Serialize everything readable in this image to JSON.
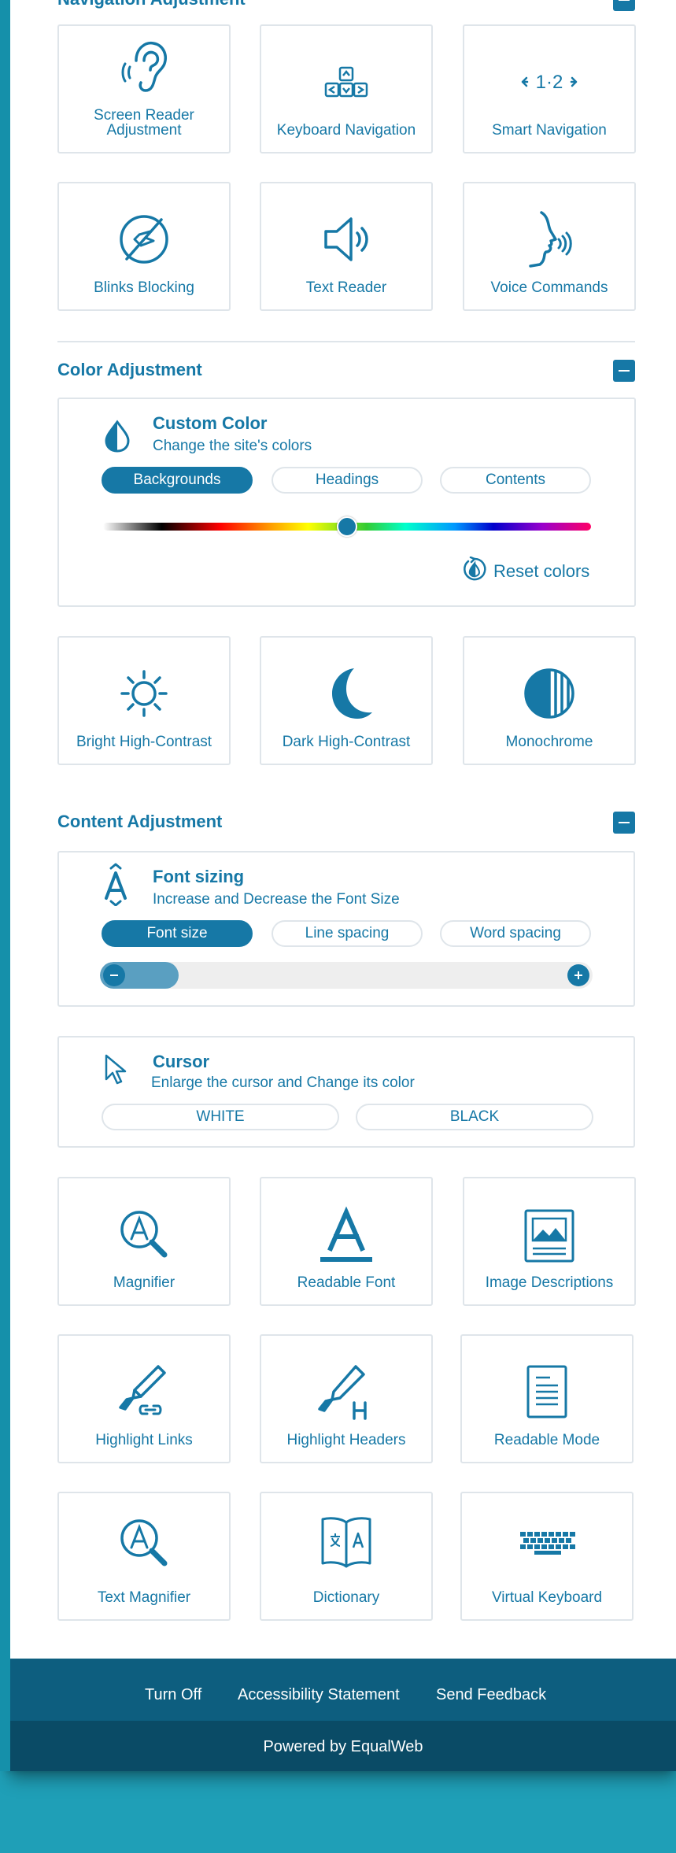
{
  "nav_section": {
    "title": "Navigation Adjustment",
    "tiles": [
      {
        "label_line1": "Screen Reader",
        "label_line2": "Adjustment",
        "icon": "ear-icon"
      },
      {
        "label": "Keyboard Navigation",
        "icon": "keyboard-arrows-icon"
      },
      {
        "label": "Smart Navigation",
        "icon": "smart-navigation-icon",
        "icon_text": "1·2"
      },
      {
        "label": "Blinks Blocking",
        "icon": "blinks-blocking-icon"
      },
      {
        "label": "Text Reader",
        "icon": "speaker-icon"
      },
      {
        "label": "Voice Commands",
        "icon": "voice-head-icon"
      }
    ]
  },
  "color_section": {
    "title": "Color Adjustment",
    "custom_color": {
      "title": "Custom Color",
      "subtitle": "Change the site's colors",
      "tabs": [
        "Backgrounds",
        "Headings",
        "Contents"
      ],
      "active_tab": "Backgrounds",
      "slider_value": 0.5,
      "reset_label": "Reset colors"
    },
    "tiles": [
      {
        "label": "Bright High-Contrast",
        "icon": "sun-icon"
      },
      {
        "label": "Dark High-Contrast",
        "icon": "moon-icon"
      },
      {
        "label": "Monochrome",
        "icon": "monochrome-icon"
      }
    ]
  },
  "content_section": {
    "title": "Content Adjustment",
    "font_sizing": {
      "title": "Font sizing",
      "subtitle": "Increase and Decrease the Font Size",
      "tabs": [
        "Font size",
        "Line spacing",
        "Word spacing"
      ],
      "active_tab": "Font size",
      "level": 0.16
    },
    "cursor": {
      "title": "Cursor",
      "subtitle": "Enlarge the cursor and Change its color",
      "options": [
        "WHITE",
        "BLACK"
      ]
    },
    "tiles": [
      {
        "label": "Magnifier",
        "icon": "magnifier-icon"
      },
      {
        "label": "Readable Font",
        "icon": "readable-font-icon"
      },
      {
        "label": "Image Descriptions",
        "icon": "image-icon"
      },
      {
        "label": "Highlight Links",
        "icon": "highlight-links-icon"
      },
      {
        "label": "Highlight Headers",
        "icon": "highlight-headers-icon"
      },
      {
        "label": "Readable Mode",
        "icon": "readable-mode-icon"
      },
      {
        "label": "Text Magnifier",
        "icon": "text-magnifier-icon"
      },
      {
        "label": "Dictionary",
        "icon": "dictionary-icon"
      },
      {
        "label": "Virtual Keyboard",
        "icon": "virtual-keyboard-icon"
      }
    ]
  },
  "footer": {
    "links": [
      "Turn Off",
      "Accessibility Statement",
      "Send Feedback"
    ],
    "powered_by": "Powered by EqualWeb"
  },
  "colors": {
    "accent": "#1678a6",
    "border": "#dfe5ea",
    "footer_top": "#0d5e7f",
    "footer_bottom": "#0a4b66",
    "page_bg": "#1f9fb7"
  }
}
